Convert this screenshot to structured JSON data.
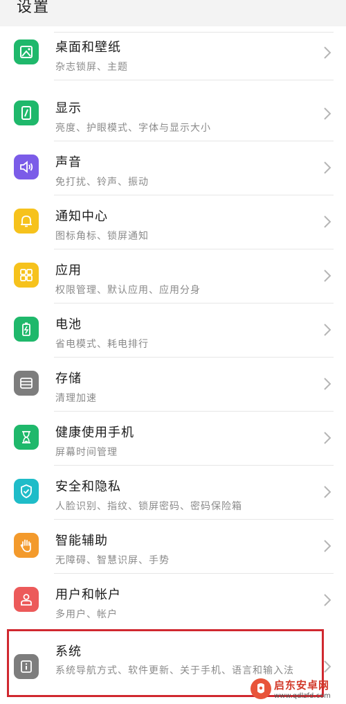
{
  "header": {
    "title": "设置"
  },
  "items": [
    {
      "title": "桌面和壁纸",
      "subtitle": "杂志锁屏、主题",
      "icon": "wallpaper-icon",
      "color": "#1fb86b"
    },
    {
      "title": "显示",
      "subtitle": "亮度、护眼模式、字体与显示大小",
      "icon": "display-icon",
      "color": "#1fb86b"
    },
    {
      "title": "声音",
      "subtitle": "免打扰、铃声、振动",
      "icon": "speaker-icon",
      "color": "#7b5ce8"
    },
    {
      "title": "通知中心",
      "subtitle": "图标角标、锁屏通知",
      "icon": "bell-icon",
      "color": "#f6c21c"
    },
    {
      "title": "应用",
      "subtitle": "权限管理、默认应用、应用分身",
      "icon": "apps-grid-icon",
      "color": "#f6c21c"
    },
    {
      "title": "电池",
      "subtitle": "省电模式、耗电排行",
      "icon": "battery-icon",
      "color": "#1fb86b"
    },
    {
      "title": "存储",
      "subtitle": "清理加速",
      "icon": "storage-icon",
      "color": "#7d7d7d"
    },
    {
      "title": "健康使用手机",
      "subtitle": "屏幕时间管理",
      "icon": "hourglass-icon",
      "color": "#1fb86b"
    },
    {
      "title": "安全和隐私",
      "subtitle": "人脸识别、指纹、锁屏密码、密码保险箱",
      "icon": "shield-icon",
      "color": "#1fbcc8"
    },
    {
      "title": "智能辅助",
      "subtitle": "无障碍、智慧识屏、手势",
      "icon": "hand-icon",
      "color": "#f39a2c"
    },
    {
      "title": "用户和帐户",
      "subtitle": "多用户、帐户",
      "icon": "user-icon",
      "color": "#ec5a5a"
    },
    {
      "title": "系统",
      "subtitle": "系统导航方式、软件更新、关于手机、语言和输入法",
      "icon": "info-icon",
      "color": "#7d7d7d"
    }
  ],
  "watermark": {
    "name": "启东安卓网",
    "url": "www.qdlzfd.com"
  }
}
